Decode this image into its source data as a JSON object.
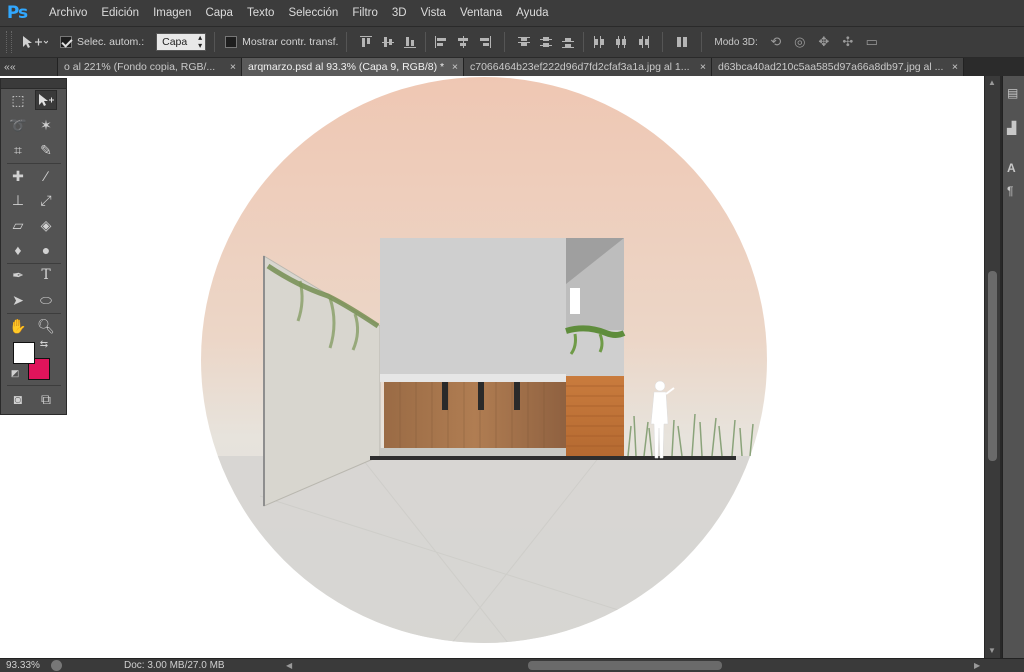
{
  "app": {
    "logo": "Ps"
  },
  "menu": [
    "Archivo",
    "Edición",
    "Imagen",
    "Capa",
    "Texto",
    "Selección",
    "Filtro",
    "3D",
    "Vista",
    "Ventana",
    "Ayuda"
  ],
  "options": {
    "auto_select_label": "Selec. autom.:",
    "auto_select_checked": true,
    "auto_select_value": "Capa",
    "transform_label": "Mostrar contr. transf.",
    "transform_checked": false,
    "mode3d_label": "Modo 3D:"
  },
  "tabs": [
    {
      "label": "o al 221% (Fondo copia, RGB/...",
      "active": false
    },
    {
      "label": "arqmarzo.psd al 93.3% (Capa 9, RGB/8) *",
      "active": true
    },
    {
      "label": "c7066464b23ef222d96d7fd2cfaf3a1a.jpg al 1...",
      "active": false
    },
    {
      "label": "d63bca40ad210c5aa585d97a66a8db97.jpg al ...",
      "active": false
    }
  ],
  "tab_nav": "««",
  "colors": {
    "foreground": "#ffffff",
    "background": "#e0145b",
    "accent": "#31a8ff"
  },
  "status": {
    "zoom": "93.33%",
    "doc": "Doc: 3.00 MB/27.0 MB"
  },
  "dock_glyphs": {
    "text_tool": "A",
    "paragraph": "¶"
  },
  "tools": [
    "marquee-tool",
    "move-tool",
    "lasso-tool",
    "magic-wand-tool",
    "crop-tool",
    "eyedropper-tool",
    "healing-brush-tool",
    "brush-tool",
    "clone-stamp-tool",
    "history-brush-tool",
    "eraser-tool",
    "paint-bucket-tool",
    "blur-tool",
    "dodge-tool",
    "pen-tool",
    "type-tool",
    "path-selection-tool",
    "ellipse-tool",
    "hand-tool",
    "zoom-tool"
  ]
}
